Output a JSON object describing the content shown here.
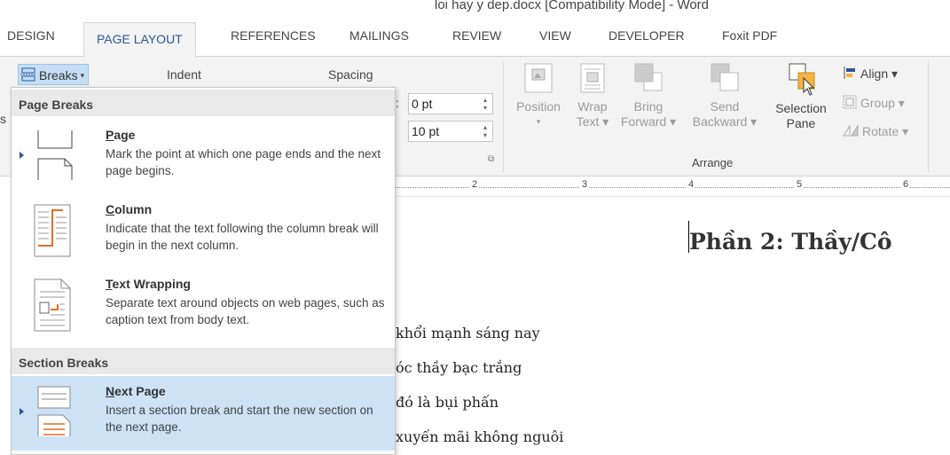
{
  "window": {
    "title": "loi hay y dep.docx [Compatibility Mode] - Word"
  },
  "tabs": [
    {
      "label": "DESIGN",
      "active": false
    },
    {
      "label": "PAGE LAYOUT",
      "active": true
    },
    {
      "label": "REFERENCES",
      "active": false
    },
    {
      "label": "MAILINGS",
      "active": false
    },
    {
      "label": "REVIEW",
      "active": false
    },
    {
      "label": "VIEW",
      "active": false
    },
    {
      "label": "DEVELOPER",
      "active": false
    },
    {
      "label": "Foxit PDF",
      "active": false
    }
  ],
  "ribbon": {
    "breaks_label": "Breaks",
    "indent_label": "Indent",
    "spacing_label": "Spacing",
    "left_stub_letter": "s",
    "spacing_before": "0 pt",
    "spacing_after": "10 pt",
    "spin_colon": ":",
    "arrange": {
      "group_label": "Arrange",
      "position": {
        "line1": "Position",
        "line2": "▾"
      },
      "wrap_text": {
        "line1": "Wrap",
        "line2": "Text ▾"
      },
      "bring_forward": {
        "line1": "Bring",
        "line2": "Forward ▾"
      },
      "send_backward": {
        "line1": "Send",
        "line2": "Backward ▾"
      },
      "selection_pane": {
        "line1": "Selection",
        "line2": "Pane"
      },
      "align": "Align ▾",
      "group": "Group ▾",
      "rotate": "Rotate ▾"
    }
  },
  "ruler": {
    "numbers": [
      "2",
      "3",
      "4",
      "5",
      "6"
    ]
  },
  "breaks_menu": {
    "page_breaks_header": "Page Breaks",
    "section_breaks_header": "Section Breaks",
    "items": [
      {
        "mnemonic": "P",
        "rest": "age",
        "desc": "Mark the point at which one page ends and the next page begins."
      },
      {
        "mnemonic": "C",
        "rest": "olumn",
        "desc": "Indicate that the text following the column break will begin in the next column."
      },
      {
        "mnemonic": "T",
        "rest": "ext Wrapping",
        "desc": "Separate text around objects on web pages, such as caption text from body text."
      },
      {
        "mnemonic": "N",
        "rest": "ext Page",
        "desc": "Insert a section break and start the new section on the next page."
      }
    ]
  },
  "document": {
    "heading": "Phần 2: Thầy/Cô",
    "lines": [
      "khổi mạnh sáng nay",
      "óc thầy bạc trắng",
      "đó là bụi phấn",
      "xuyến mãi không nguôi"
    ]
  },
  "colors": {
    "accent": "#2b579a",
    "hover": "#cde2f5",
    "ribbon_bg": "#f3f3f3"
  }
}
